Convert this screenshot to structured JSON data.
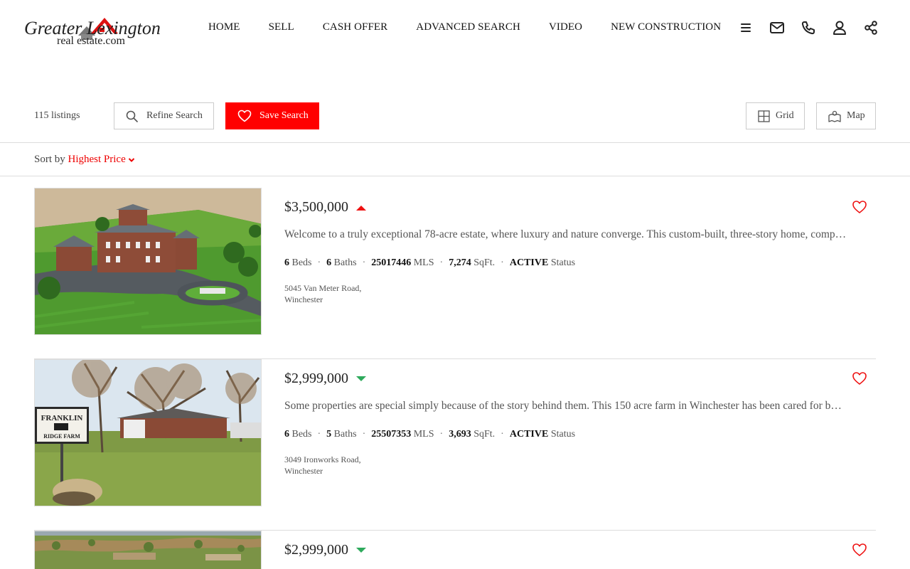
{
  "header": {
    "logo_top": "Greater Lexington",
    "logo_bottom": "real estate.com",
    "nav": [
      "HOME",
      "SELL",
      "CASH OFFER",
      "ADVANCED SEARCH",
      "VIDEO",
      "NEW CONSTRUCTION"
    ],
    "icons": [
      "menu-icon",
      "mail-icon",
      "phone-icon",
      "user-icon",
      "share-icon"
    ]
  },
  "toolbar": {
    "count": "115 listings",
    "refine_label": "Refine Search",
    "save_label": "Save Search",
    "grid_label": "Grid",
    "map_label": "Map"
  },
  "sort": {
    "prefix": "Sort by",
    "value": "Highest Price"
  },
  "colors": {
    "accent": "#ff0000",
    "price_up": "#ee1111",
    "price_down": "#2eaa5c"
  },
  "listings": [
    {
      "price": "$3,500,000",
      "trend": "up",
      "description": "Welcome to a truly exceptional 78-acre estate, where luxury and nature converge. This custom-built, three-story home, comp…",
      "beds": "6",
      "beds_label": "Beds",
      "baths": "6",
      "baths_label": "Baths",
      "mls": "25017446",
      "mls_label": "MLS",
      "sqft": "7,274",
      "sqft_label": "SqFt.",
      "status": "ACTIVE",
      "status_label": "Status",
      "address_line1": "5045 Van Meter Road,",
      "address_line2": "Winchester"
    },
    {
      "price": "$2,999,000",
      "trend": "down",
      "description": "Some properties are special simply because of the story behind them. This 150 acre farm in Winchester has been cared for b…",
      "beds": "6",
      "beds_label": "Beds",
      "baths": "5",
      "baths_label": "Baths",
      "mls": "25507353",
      "mls_label": "MLS",
      "sqft": "3,693",
      "sqft_label": "SqFt.",
      "status": "ACTIVE",
      "status_label": "Status",
      "address_line1": "3049 Ironworks Road,",
      "address_line2": "Winchester",
      "sign_line1": "FRANKLIN",
      "sign_line2": "RIDGE FARM"
    },
    {
      "price": "$2,999,000",
      "trend": "down"
    }
  ]
}
